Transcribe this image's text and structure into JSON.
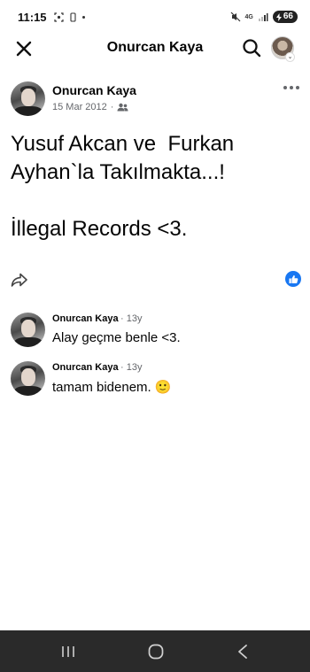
{
  "status_bar": {
    "time": "11:15",
    "network_type": "4G",
    "battery": "66"
  },
  "app_bar": {
    "title": "Onurcan Kaya"
  },
  "post": {
    "author": "Onurcan Kaya",
    "date": "15 Mar 2012",
    "text": "Yusuf Akcan ve  Furkan Ayhan`la Takılmakta...!\n\nİllegal Records <3."
  },
  "comments": [
    {
      "author": "Onurcan Kaya",
      "time": "13y",
      "text": "Alay geçme benle <3."
    },
    {
      "author": "Onurcan Kaya",
      "time": "13y",
      "text": "tamam bidenem. 🙂"
    }
  ],
  "colors": {
    "accent": "#1877f2",
    "secondary_text": "#65676b",
    "nav_bar": "#2a2a2a"
  },
  "icons": {
    "close": "close-icon",
    "search": "search-icon",
    "more": "more-icon",
    "share": "share-icon",
    "like": "like-icon",
    "audience": "friends-icon"
  }
}
